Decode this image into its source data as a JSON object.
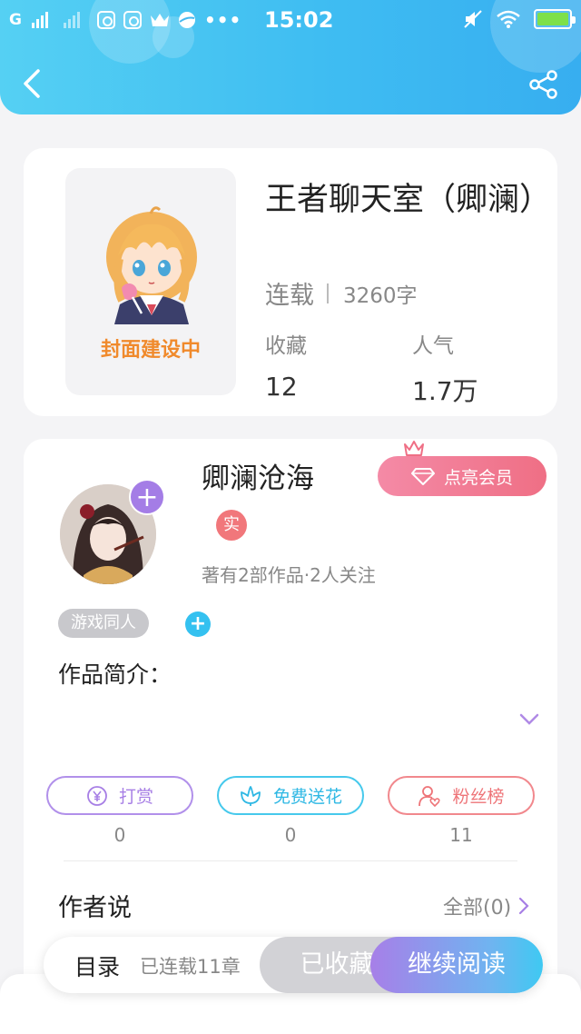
{
  "statusbar": {
    "network": "G",
    "time": "15:02"
  },
  "book": {
    "title": "王者聊天室（卿澜）",
    "cover_label": "封面建设中",
    "status": "连载",
    "word_count": "3260字",
    "stats": [
      {
        "label": "收藏",
        "value": "12"
      },
      {
        "label": "人气",
        "value": "1.7万"
      }
    ]
  },
  "author": {
    "name": "卿澜沧海",
    "real_badge": "实",
    "meta": "著有2部作品·2人关注",
    "vip_button": "点亮会员",
    "tag": "游戏同人"
  },
  "intro": {
    "label": "作品简介："
  },
  "actions": [
    {
      "label": "打赏",
      "count": "0"
    },
    {
      "label": "免费送花",
      "count": "0"
    },
    {
      "label": "粉丝榜",
      "count": "11"
    }
  ],
  "author_says": {
    "label": "作者说",
    "all": "全部(0)"
  },
  "bottom": {
    "toc": "目录",
    "chapters": "已连载11章",
    "collected": "已收藏",
    "continue": "继续阅读"
  },
  "colors": {
    "header": "#3fbdf2",
    "accent_purple": "#a77fe5",
    "accent_cyan": "#2fb8e4",
    "accent_red": "#ee7478"
  }
}
